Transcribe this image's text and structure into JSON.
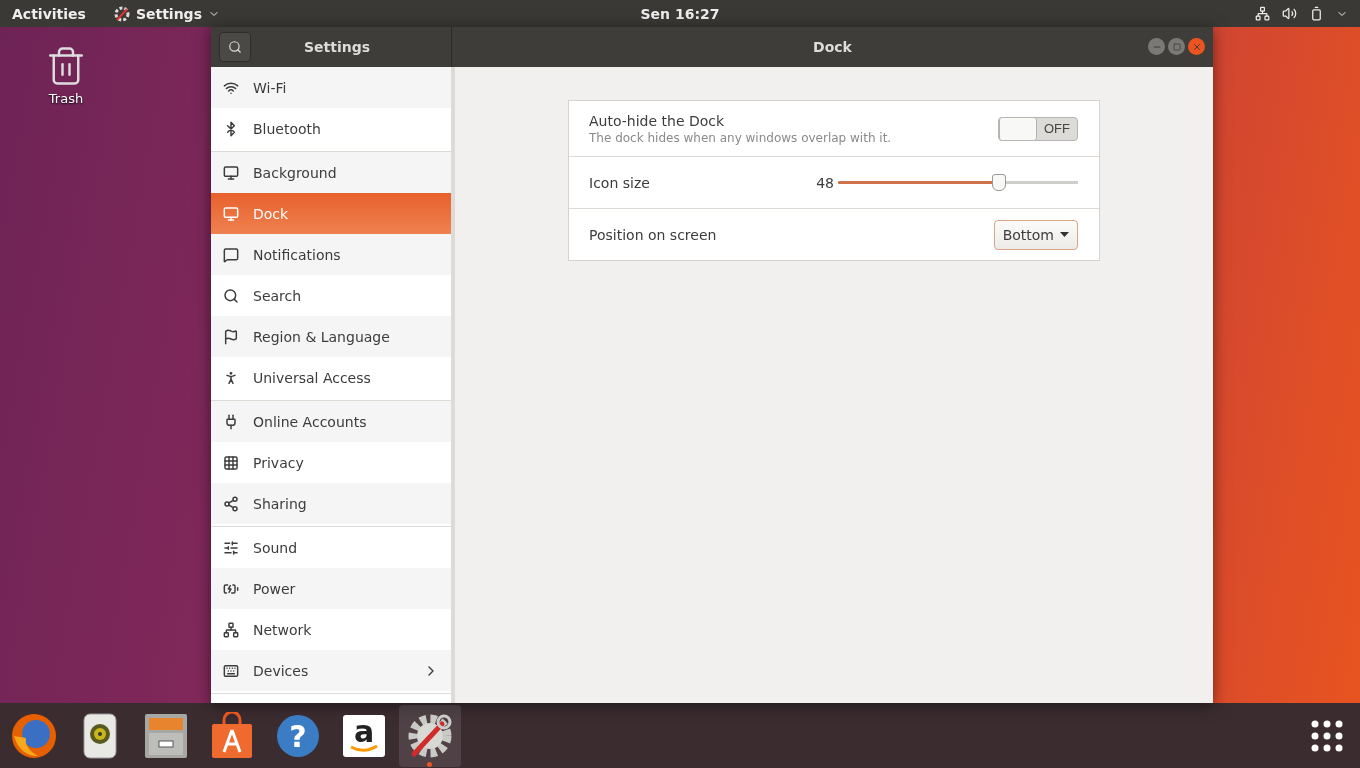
{
  "top_bar": {
    "activities": "Activities",
    "app_menu": "Settings",
    "clock": "Sen 16:27"
  },
  "desktop_icons": [
    {
      "label": "Trash"
    }
  ],
  "window": {
    "sidebar_title": "Settings",
    "title": "Dock"
  },
  "sidebar": {
    "groups": [
      [
        {
          "label": "Wi-Fi",
          "selected": false
        },
        {
          "label": "Bluetooth",
          "selected": false
        }
      ],
      [
        {
          "label": "Background",
          "selected": false
        },
        {
          "label": "Dock",
          "selected": true
        },
        {
          "label": "Notifications",
          "selected": false
        },
        {
          "label": "Search",
          "selected": false
        },
        {
          "label": "Region & Language",
          "selected": false
        },
        {
          "label": "Universal Access",
          "selected": false
        }
      ],
      [
        {
          "label": "Online Accounts",
          "selected": false
        },
        {
          "label": "Privacy",
          "selected": false
        },
        {
          "label": "Sharing",
          "selected": false
        }
      ],
      [
        {
          "label": "Sound",
          "selected": false
        },
        {
          "label": "Power",
          "selected": false
        },
        {
          "label": "Network",
          "selected": false
        },
        {
          "label": "Devices",
          "selected": false,
          "has_submenu": true
        }
      ]
    ]
  },
  "settings": [
    {
      "kind": "switch",
      "label": "Auto-hide the Dock",
      "description": "The dock hides when any windows overlap with it.",
      "on": false,
      "state_text": "OFF"
    },
    {
      "kind": "slider",
      "label": "Icon size",
      "reading": "48",
      "level": 0.667
    },
    {
      "kind": "dropdown",
      "label": "Position on screen",
      "value": "Bottom"
    }
  ],
  "dock": [
    {
      "kind": "firefox",
      "running": false
    },
    {
      "kind": "music",
      "running": false
    },
    {
      "kind": "files",
      "running": false
    },
    {
      "kind": "store",
      "running": false
    },
    {
      "kind": "help",
      "glyph": "?",
      "running": false
    },
    {
      "kind": "amazon",
      "glyph": "a",
      "running": false
    },
    {
      "kind": "settings",
      "running": true
    }
  ]
}
